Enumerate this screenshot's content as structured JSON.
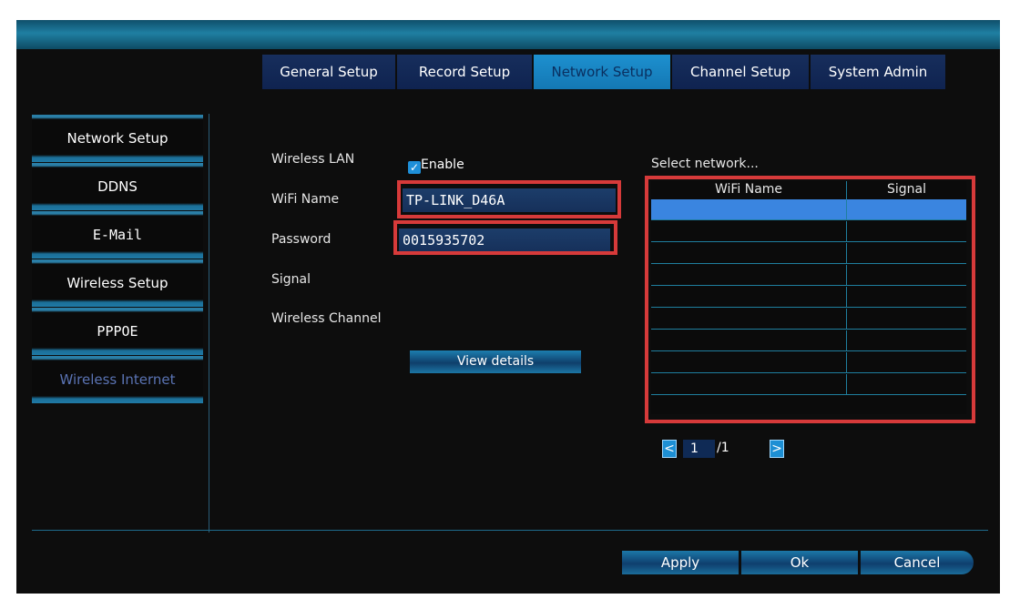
{
  "tabs": [
    "General Setup",
    "Record Setup",
    "Network Setup",
    "Channel Setup",
    "System Admin"
  ],
  "active_tab": "Network Setup",
  "sidebar": {
    "items": [
      "Network Setup",
      "DDNS",
      "E-Mail",
      "Wireless Setup",
      "PPPOE",
      "Wireless Internet"
    ]
  },
  "form": {
    "wireless_lan_label": "Wireless LAN",
    "enable_label": "Enable",
    "enable_checked": true,
    "wifi_name_label": "WiFi Name",
    "wifi_name_value": "TP-LINK_D46A",
    "password_label": "Password",
    "password_value": "0015935702",
    "signal_label": "Signal",
    "wireless_channel_label": "Wireless Channel",
    "view_details": "View details"
  },
  "network_list": {
    "title": "Select network...",
    "columns": [
      "WiFi Name",
      "Signal"
    ]
  },
  "pager": {
    "prev_icon": "<",
    "next_icon": ">",
    "current": "1",
    "total": "/1"
  },
  "buttons": {
    "apply": "Apply",
    "ok": "Ok",
    "cancel": "Cancel"
  },
  "colors": {
    "tab_active": "#1d90cf",
    "tab": "#172e5c",
    "highlight_box": "#d63a3a",
    "row_selected": "#3a85e0"
  }
}
